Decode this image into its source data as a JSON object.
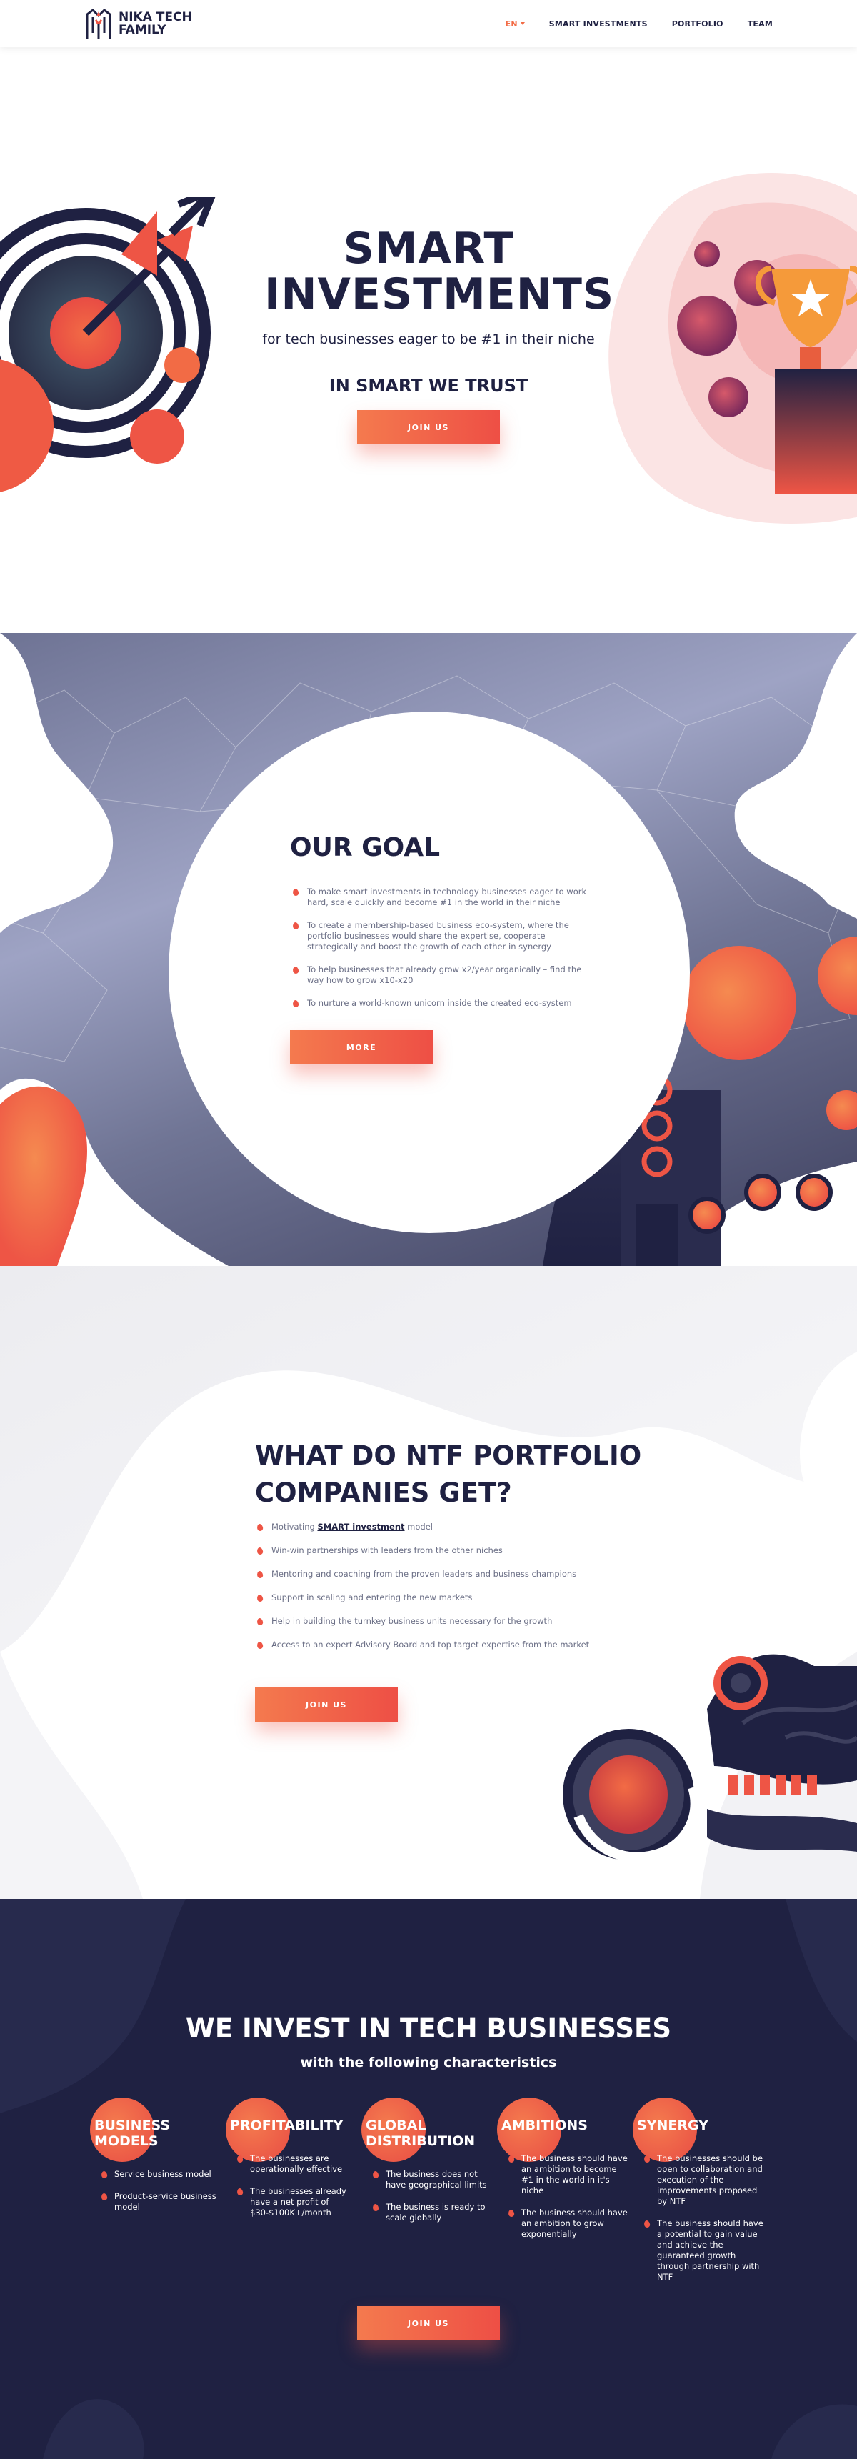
{
  "header": {
    "logo_text": "NIKA TECH FAMILY",
    "nav": [
      {
        "label": "EN"
      },
      {
        "label": "SMART INVESTMENTS"
      },
      {
        "label": "PORTFOLIO"
      },
      {
        "label": "TEAM"
      }
    ]
  },
  "hero": {
    "title": "SMART INVESTMENTS",
    "subtitle": "for tech businesses eager to be #1 in their niche",
    "motto": "IN SMART WE TRUST",
    "button": "JOIN US"
  },
  "goal": {
    "title": "OUR GOAL",
    "items": [
      "To make smart investments in technology businesses eager to work hard, scale quickly and become #1 in the world in their niche",
      "To create a membership-based business eco-system, where the portfolio businesses would share the expertise, cooperate strategically and boost the growth of each other in synergy",
      "To help businesses that already grow x2/year organically – find the way how to grow x10-x20",
      "To nurture a world-known unicorn inside the created eco-system"
    ],
    "button": "MORE"
  },
  "portfolio": {
    "title": "WHAT DO NTF PORTFOLIO COMPANIES GET?",
    "first_item": {
      "prefix": "Motivating ",
      "link": "SMART investment",
      "suffix": " model"
    },
    "items": [
      "Win-win partnerships with leaders from the other niches",
      "Mentoring and coaching from the proven leaders and business champions",
      "Support in scaling and entering the new markets",
      "Help in building the turnkey business units necessary for the growth",
      "Access to an expert Advisory Board and top target expertise from the market"
    ],
    "button": "JOIN US"
  },
  "invest": {
    "title": "WE INVEST IN TECH BUSINESSES",
    "subtitle": "with the following characteristics",
    "columns": [
      {
        "title": "BUSINESS MODELS",
        "items": [
          "Service business model",
          "Product-service business model"
        ]
      },
      {
        "title": "PROFITABILITY",
        "items": [
          "The businesses are operationally effective",
          "The businesses already have a net profit of $30-$100K+/month"
        ]
      },
      {
        "title": "GLOBAL DISTRIBUTION",
        "items": [
          "The business does not have geographical limits",
          "The business is ready to scale globally"
        ]
      },
      {
        "title": "AMBITIONS",
        "items": [
          "The business should have an ambition to become #1 in the world in it's niche",
          "The business should have an ambition to grow exponentially"
        ]
      },
      {
        "title": "SYNERGY",
        "items": [
          "The businesses should be open to collaboration and execution of the improvements proposed by NTF",
          "The business should have a potential to gain value and achieve the guaranteed growth through partnership with NTF"
        ]
      }
    ],
    "button": "JOIN US"
  },
  "colors": {
    "navy": "#1f2142",
    "accent": "#ee5545",
    "accent_light": "#f47a4e"
  }
}
